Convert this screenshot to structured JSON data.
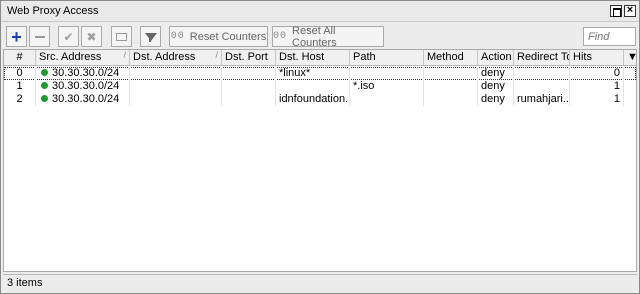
{
  "window": {
    "title": "Web Proxy Access"
  },
  "toolbar": {
    "reset_counters": "Reset Counters",
    "reset_all_counters": "Reset All Counters",
    "counter_glyph": "00",
    "find_placeholder": "Find"
  },
  "columns": [
    "#",
    "Src. Address",
    "Dst. Address",
    "Dst. Port",
    "Dst. Host",
    "Path",
    "Method",
    "Action",
    "Redirect To",
    "Hits"
  ],
  "rows": [
    {
      "idx": "0",
      "src": "30.30.30.0/24",
      "dst": "",
      "port": "",
      "host": "*linux*",
      "path": "",
      "method": "",
      "action": "deny",
      "redirect": "",
      "hits": "0"
    },
    {
      "idx": "1",
      "src": "30.30.30.0/24",
      "dst": "",
      "port": "",
      "host": "",
      "path": "*.iso",
      "method": "",
      "action": "deny",
      "redirect": "",
      "hits": "1"
    },
    {
      "idx": "2",
      "src": "30.30.30.0/24",
      "dst": "",
      "port": "",
      "host": "idnfoundation...",
      "path": "",
      "method": "",
      "action": "deny",
      "redirect": "rumahjari...",
      "hits": "1"
    }
  ],
  "status": {
    "items_text": "3 items"
  }
}
